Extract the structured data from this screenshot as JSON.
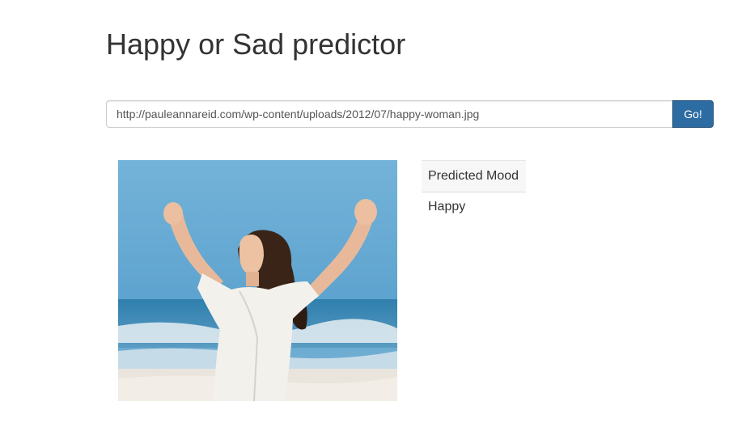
{
  "page": {
    "title": "Happy or Sad predictor"
  },
  "form": {
    "url_value": "http://pauleannareid.com/wp-content/uploads/2012/07/happy-woman.jpg",
    "button_label": "Go!"
  },
  "image": {
    "alt": "happy woman at the beach with arms raised"
  },
  "results": {
    "header": "Predicted Mood",
    "value": "Happy"
  },
  "colors": {
    "button": "#2d6ca2",
    "sky": "#6aa9d0",
    "sea": "#3d8db8"
  }
}
